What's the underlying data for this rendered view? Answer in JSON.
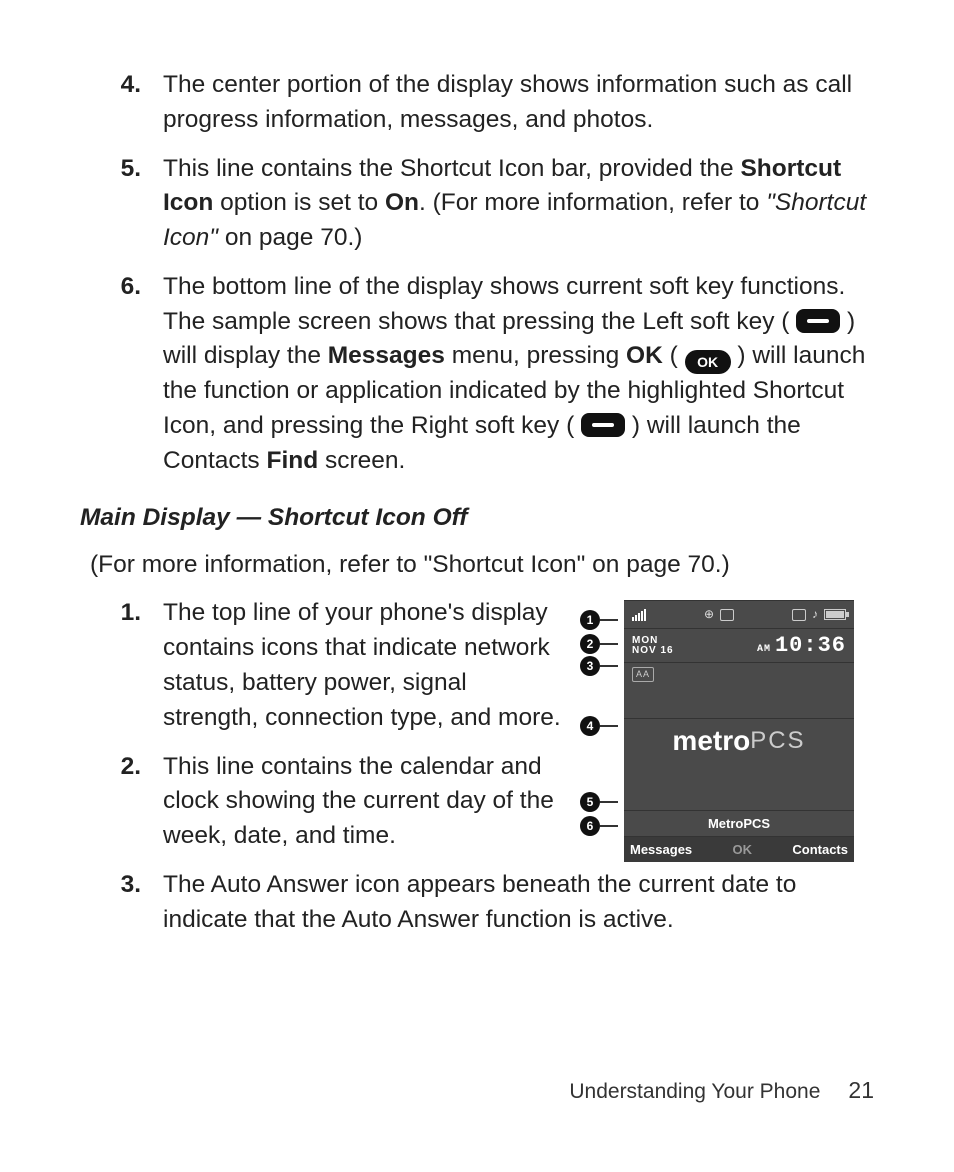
{
  "list_a": [
    {
      "num": "4.",
      "text": "The center portion of the display shows information such as call progress information, messages, and photos."
    }
  ],
  "item5": {
    "num": "5.",
    "t1": "This line contains the Shortcut Icon bar, provided the ",
    "b1": "Shortcut Icon",
    "t2": " option is set to ",
    "b2": "On",
    "t3": ". (For more information, refer to ",
    "it": "\"Shortcut Icon\"",
    "t4": " on page 70.)"
  },
  "item6": {
    "num": "6.",
    "t1": "The bottom line of the display shows current soft key functions. The sample screen shows that pressing the Left soft key ( ",
    "t2": " ) will display the ",
    "b1": "Messages",
    "t3": " menu, pressing ",
    "b2": "OK",
    "t4": " ( ",
    "ok": "OK",
    "t5": " ) will launch the function or application indicated by the highlighted Shortcut Icon, and pressing the Right soft key ( ",
    "t6": " ) will launch the Contacts ",
    "b3": "Find",
    "t7": " screen."
  },
  "heading": "Main Display — Shortcut Icon Off",
  "refline": {
    "t1": "(For more information, refer to ",
    "it": "\"Shortcut Icon\"",
    "t2": " on page 70.)"
  },
  "list_b": [
    {
      "num": "1.",
      "text": "The top line of your phone's display contains icons that indicate network status, battery power, signal strength, connection type, and more."
    },
    {
      "num": "2.",
      "text": "This line contains the calendar and clock showing the current day of the week, date, and time."
    }
  ],
  "item_b3": {
    "num": "3.",
    "text": "The Auto Answer icon appears beneath the current date to indicate that the Auto Answer function is active."
  },
  "callouts": [
    "1",
    "2",
    "3",
    "4",
    "5",
    "6"
  ],
  "callout_gaps": [
    10,
    4,
    2,
    40,
    56,
    4
  ],
  "phone": {
    "day": "MON",
    "date": "NOV 16",
    "ampm": "AM",
    "time": "10:36",
    "aa": "AA",
    "brand_bold": "metro",
    "brand_light": "PCS",
    "carrier": "MetroPCS",
    "left_sk": "Messages",
    "mid_sk": "OK",
    "right_sk": "Contacts"
  },
  "footer": {
    "section": "Understanding Your Phone",
    "page": "21"
  }
}
